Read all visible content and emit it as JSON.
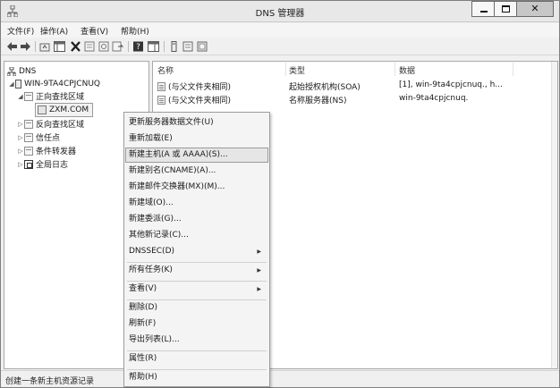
{
  "window": {
    "title": "DNS 管理器"
  },
  "menubar": [
    "文件(F)",
    "操作(A)",
    "查看(V)",
    "帮助(H)"
  ],
  "tree": {
    "root": "DNS",
    "server": "WIN-9TA4CPJCNUQ",
    "forward": "正向查找区域",
    "zone": "ZXM.COM",
    "reverse": "反向查找区域",
    "trust": "信任点",
    "conditional": "条件转发器",
    "logs": "全局日志"
  },
  "list": {
    "columns": [
      "名称",
      "类型",
      "数据"
    ],
    "rows": [
      {
        "name": "(与父文件夹相同)",
        "type": "起始授权机构(SOA)",
        "data": "[1], win-9ta4cpjcnuq., h..."
      },
      {
        "name": "(与父文件夹相同)",
        "type": "名称服务器(NS)",
        "data": "win-9ta4cpjcnuq."
      }
    ]
  },
  "context_menu": {
    "update": "更新服务器数据文件(U)",
    "reload": "重新加载(E)",
    "new_host": "新建主机(A 或 AAAA)(S)...",
    "new_alias": "新建别名(CNAME)(A)...",
    "new_mx": "新建邮件交换器(MX)(M)...",
    "new_domain": "新建域(O)...",
    "new_delegation": "新建委派(G)...",
    "other_records": "其他新记录(C)...",
    "dnssec": "DNSSEC(D)",
    "all_tasks": "所有任务(K)",
    "view": "查看(V)",
    "delete": "删除(D)",
    "refresh": "刷新(F)",
    "export": "导出列表(L)...",
    "properties": "属性(R)",
    "help": "帮助(H)"
  },
  "status": "创建一条新主机资源记录"
}
